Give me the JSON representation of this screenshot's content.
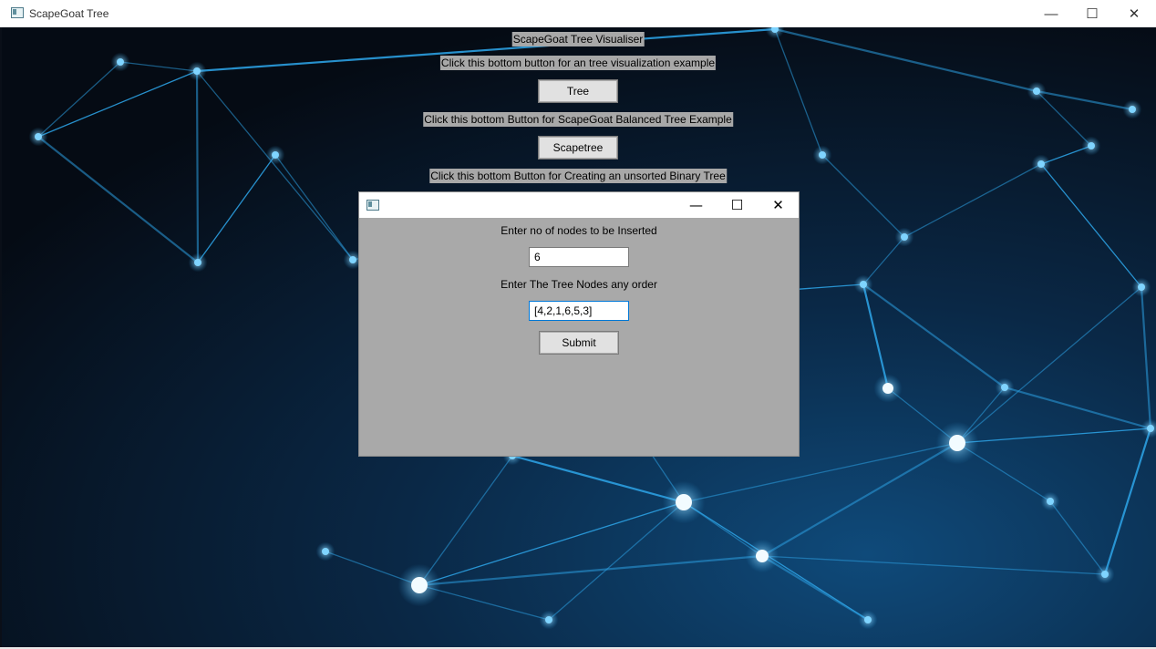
{
  "main_window": {
    "title": "ScapeGoat Tree",
    "icon": "app-window-icon",
    "controls": {
      "minimize": "—",
      "maximize": "☐",
      "close": "✕"
    }
  },
  "content": {
    "heading": "ScapeGoat Tree Visualiser",
    "tree_prompt": "Click this bottom button for an tree visualization example",
    "tree_button": "Tree",
    "scape_prompt": "Click this bottom Button for ScapeGoat Balanced Tree Example",
    "scape_button": "Scapetree",
    "binary_prompt": "Click this bottom Button for Creating an unsorted Binary Tree"
  },
  "dialog": {
    "title": "",
    "icon": "dialog-window-icon",
    "controls": {
      "minimize": "—",
      "maximize": "☐",
      "close": "✕"
    },
    "nodes_label": "Enter no of nodes to be Inserted",
    "nodes_value": "6",
    "order_label": "Enter The Tree Nodes any order",
    "order_value": "[4,2,1,6,5,3]",
    "submit": "Submit"
  },
  "colors": {
    "label_bg": "#a8a8a8",
    "dialog_bg": "#a9a9a9",
    "network_node": "#7fd4ff",
    "network_line": "#2b9fe0"
  }
}
